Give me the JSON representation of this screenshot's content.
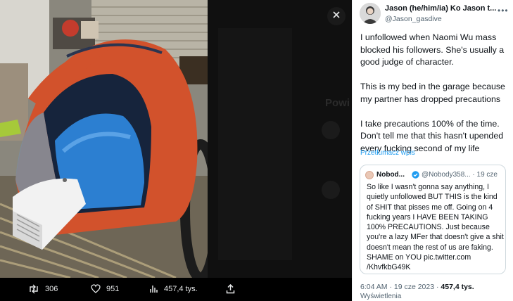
{
  "nav": {
    "close_label": "Close"
  },
  "actions": {
    "retweets": "306",
    "likes": "951",
    "views": "457,4 tys."
  },
  "tweet": {
    "author_name": "Jason (he/him/ia) Ko Jason t...",
    "author_handle": "@Jason_gasdive",
    "paragraphs": [
      "I unfollowed when Naomi Wu mass blocked his followers. She's usually a good judge of character.",
      "This is my bed in the garage because my partner has dropped precautions",
      "I take precautions 100% of the time. Don't tell me that this hasn't upended every fucking second of my life"
    ],
    "translate_label": "Przetłumacz wpis",
    "timestamp": "6:04 AM · 19 cze 2023 ·",
    "views_count": "457,4 tys.",
    "views_label": "Wyświetlenia"
  },
  "quote": {
    "name": "Nobod...",
    "handle": "@Nobody358... · 19 cze",
    "text": "So like I wasn't gonna say anything, I quietly unfollowed BUT THIS is the kind of SHIT that pisses me off.  Going on 4 fucking years I HAVE BEEN TAKING 100% PRECAUTIONS. Just because you're a lazy MFer that doesn't give a shit doesn't mean the rest of us are faking. SHAME on YOU pic.twitter.com /KhvfkbG49K"
  },
  "background_text": "Powi",
  "colors": {
    "accent": "#1d9bf0",
    "text_primary": "#0f1419",
    "text_secondary": "#536471",
    "tent_orange": "#d2522c",
    "tent_blue": "#2c7fd1"
  },
  "icons": {
    "close": "close-icon",
    "retweet": "retweet-icon",
    "like": "heart-icon",
    "views": "views-icon",
    "share": "share-icon",
    "more": "more-icon",
    "verified": "verified-badge-icon"
  }
}
